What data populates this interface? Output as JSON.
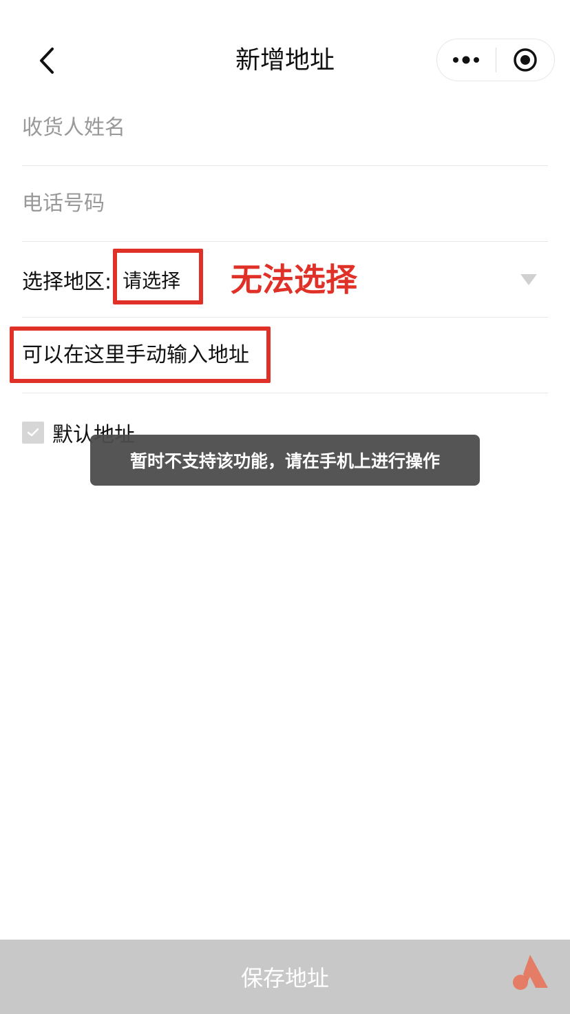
{
  "header": {
    "title": "新增地址",
    "back_icon": "chevron-left-icon",
    "more_icon": "more-dots-icon",
    "close_icon": "target-circle-icon"
  },
  "form": {
    "name_placeholder": "收货人姓名",
    "phone_placeholder": "电话号码",
    "region_label": "选择地区:",
    "region_value": "请选择",
    "address_placeholder": "可以在这里手动输入地址"
  },
  "default_address": {
    "label": "默认地址",
    "checked": true
  },
  "annotation": {
    "text": "无法选择",
    "color": "#e03128"
  },
  "toast": {
    "message": "暂时不支持该功能，请在手机上进行操作"
  },
  "footer": {
    "save_label": "保存地址"
  },
  "colors": {
    "save_button_bg": "#c8c8c8",
    "placeholder": "#999999"
  }
}
